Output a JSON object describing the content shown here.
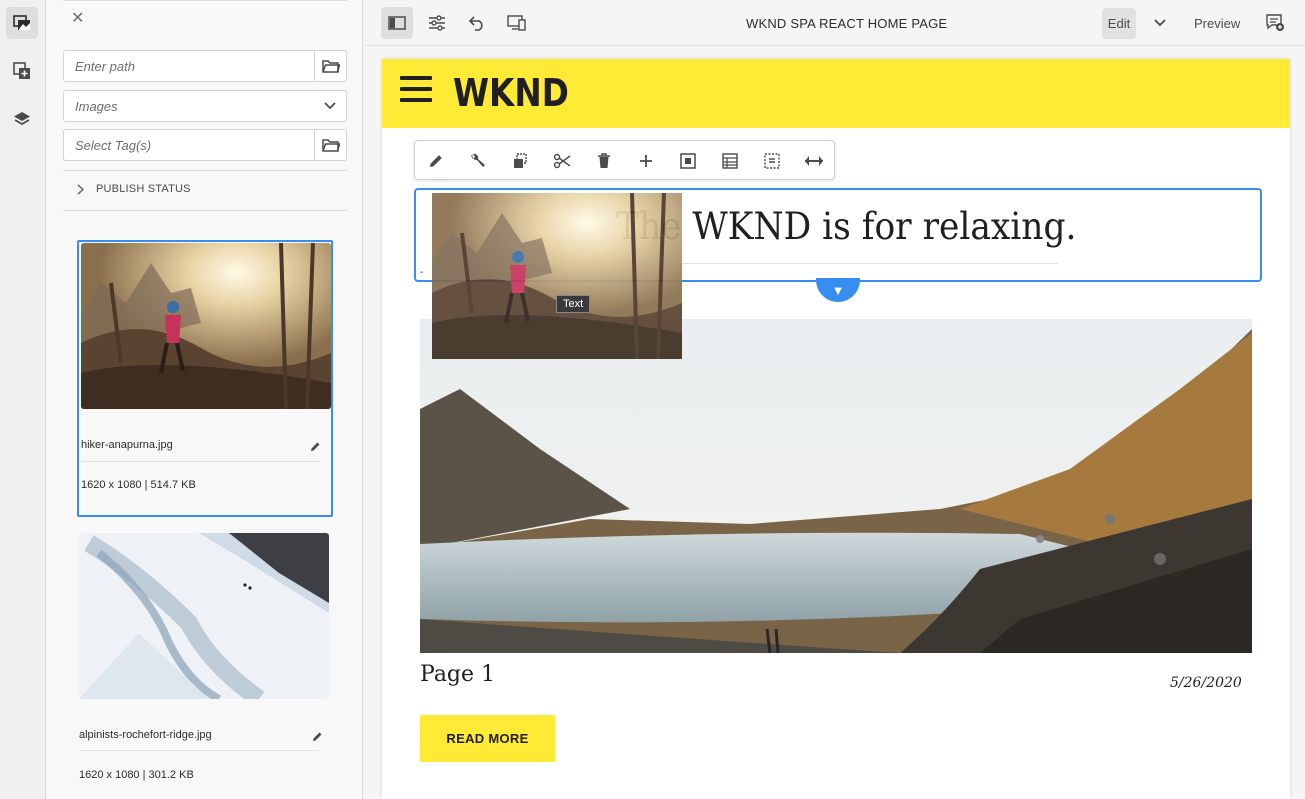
{
  "rail": {
    "items": [
      {
        "icon": "assets-icon",
        "active": true
      },
      {
        "icon": "components-icon",
        "active": false
      },
      {
        "icon": "layers-icon",
        "active": false
      }
    ]
  },
  "assets_panel": {
    "path_placeholder": "Enter path",
    "type_selected": "Images",
    "tags_placeholder": "Select Tag(s)",
    "publish_status_label": "PUBLISH STATUS",
    "assets": [
      {
        "name": "hiker-anapurna.jpg",
        "meta": "1620 x 1080 | 514.7 KB",
        "selected": true
      },
      {
        "name": "alpinists-rochefort-ridge.jpg",
        "meta": "1620 x 1080 | 301.2 KB",
        "selected": false
      }
    ]
  },
  "toolbar": {
    "page_title": "WKND SPA REACT HOME PAGE",
    "edit_label": "Edit",
    "preview_label": "Preview"
  },
  "site": {
    "logo": "WKND",
    "headline": "The WKND is for relaxing.",
    "drag_label": "Text",
    "card_title": "Page 1",
    "card_date": "5/26/2020",
    "read_more": "READ MORE",
    "dash": "-"
  },
  "colors": {
    "brand_yellow": "#ffea35",
    "selection_blue": "#378ef0"
  }
}
